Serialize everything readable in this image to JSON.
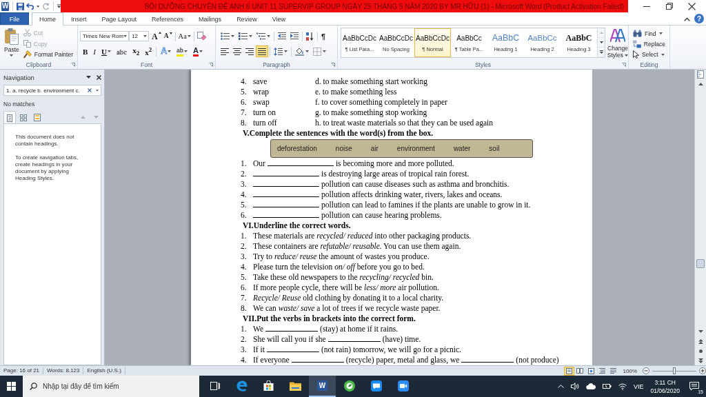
{
  "window": {
    "app_letter": "W",
    "title": "BỒI DƯỠNG CHUYÊN ĐỀ ANH 6 UNIT 11 SUPERVIP GROUP NGÀY 25 THÁNG 5 NĂM 2020 BY MR HỮU (1) - Microsoft Word (Product Activation Failed)"
  },
  "quick_access": [
    {
      "kind": "save",
      "disabled": false
    },
    {
      "kind": "undo",
      "disabled": false
    },
    {
      "kind": "redo",
      "disabled": true
    }
  ],
  "ribbon_tabs": [
    {
      "label": "File",
      "kind": "file",
      "selected": false
    },
    {
      "label": "Home",
      "kind": "tab",
      "selected": true
    },
    {
      "label": "Insert",
      "kind": "tab",
      "selected": false
    },
    {
      "label": "Page Layout",
      "kind": "tab",
      "selected": false
    },
    {
      "label": "References",
      "kind": "tab",
      "selected": false
    },
    {
      "label": "Mailings",
      "kind": "tab",
      "selected": false
    },
    {
      "label": "Review",
      "kind": "tab",
      "selected": false
    },
    {
      "label": "View",
      "kind": "tab",
      "selected": false
    }
  ],
  "help": "?",
  "clipboard": {
    "paste": "Paste",
    "commands": [
      {
        "kind": "cut",
        "label": "Cut",
        "disabled": true
      },
      {
        "kind": "copy",
        "label": "Copy",
        "disabled": true
      },
      {
        "kind": "format_painter",
        "label": "Format Painter",
        "disabled": false
      }
    ],
    "label": "Clipboard"
  },
  "font": {
    "name": "Times New Rom",
    "size": "12",
    "grow": "A",
    "shrink": "A",
    "change_case": "Aa",
    "formats": [
      {
        "kind": "bold",
        "label": "B",
        "menu": false
      },
      {
        "kind": "italic",
        "label": "I",
        "menu": false
      },
      {
        "kind": "underline",
        "label": "U",
        "menu": true
      },
      {
        "kind": "strikethrough",
        "label": "abc",
        "menu": false
      },
      {
        "kind": "subscript",
        "label": "x$_{2}$",
        "menu": false
      },
      {
        "kind": "superscript",
        "label": "x$^{2}$",
        "menu": false
      }
    ],
    "effects": [
      {
        "kind": "text_effects",
        "label": "A"
      },
      {
        "kind": "highlight",
        "label": "ab"
      },
      {
        "kind": "font_color",
        "label": "A"
      }
    ],
    "label": "Font"
  },
  "paragraph": {
    "show_marks": "¶",
    "align": [
      {
        "kind": "left",
        "selected": false
      },
      {
        "kind": "center",
        "selected": false
      },
      {
        "kind": "right",
        "selected": false
      },
      {
        "kind": "justify",
        "selected": true
      }
    ],
    "label": "Paragraph"
  },
  "styles": {
    "gallery": [
      {
        "preview": "AaBbCcDc",
        "name": "¶ List Para...",
        "kind": "body",
        "selected": false
      },
      {
        "preview": "AaBbCcDc",
        "name": "No Spacing",
        "kind": "body",
        "selected": false
      },
      {
        "preview": "AaBbCcDc",
        "name": "¶ Normal",
        "kind": "body",
        "selected": true
      },
      {
        "preview": "AaBbCc",
        "name": "¶ Table Pa...",
        "kind": "body",
        "selected": false
      },
      {
        "preview": "AaBbC",
        "name": "Heading 1",
        "kind": "heading1",
        "selected": false
      },
      {
        "preview": "AaBbCc",
        "name": "Heading 2",
        "kind": "heading2",
        "selected": false
      },
      {
        "preview": "AaBbC",
        "name": "Heading 3",
        "kind": "heading3",
        "selected": false
      }
    ],
    "change_styles": "Change Styles",
    "label": "Styles"
  },
  "editing": {
    "commands": [
      {
        "kind": "find",
        "label": "Find",
        "menu": true
      },
      {
        "kind": "replace",
        "label": "Replace",
        "menu": false
      },
      {
        "kind": "select",
        "label": "Select",
        "menu": true
      }
    ],
    "label": "Editing"
  },
  "navigation": {
    "title": "Navigation",
    "search": {
      "value": "1. a. recycle b. environment c."
    },
    "status": "No matches",
    "view_tabs": [
      {
        "kind": "headings",
        "selected": true
      },
      {
        "kind": "pages",
        "selected": false
      },
      {
        "kind": "results",
        "selected": false
      }
    ],
    "result_arrows": [
      {
        "kind": "previous",
        "disabled": true
      },
      {
        "kind": "next",
        "disabled": true
      }
    ],
    "message": [
      "This document does not contain headings.",
      "To create navigation tabs, create headings in your document by applying Heading Styles."
    ]
  },
  "document": {
    "matching": [
      {
        "number": "4.",
        "word": "save",
        "definition": "d. to make something start working"
      },
      {
        "number": "5.",
        "word": "wrap",
        "definition": "e. to make something less"
      },
      {
        "number": "6.",
        "word": "swap",
        "definition": "f. to cover something completely in paper"
      },
      {
        "number": "7.",
        "word": "turn on",
        "definition": "g. to make something stop working"
      },
      {
        "number": "8.",
        "word": "turn off",
        "definition": "h. to treat waste materials so that they can be used again"
      }
    ],
    "exercise_5": {
      "heading": "V.Complete the sentences with the word(s) from the box.",
      "word_box": [
        "deforestation",
        "noise",
        "air",
        "environment",
        "water",
        "soil"
      ],
      "items": [
        {
          "number": "1.",
          "parts": [
            {
              "kind": "text",
              "text": "Our"
            },
            {
              "kind": "blank"
            },
            {
              "kind": "text",
              "text": "is becoming more and more polluted."
            }
          ]
        },
        {
          "number": "2.",
          "parts": [
            {
              "kind": "blank"
            },
            {
              "kind": "text",
              "text": "is destroying large areas of tropical rain forest."
            }
          ]
        },
        {
          "number": "3.",
          "parts": [
            {
              "kind": "blank"
            },
            {
              "kind": "text",
              "text": "pollution can cause diseases such as asthma and bronchitis."
            }
          ]
        },
        {
          "number": "4.",
          "parts": [
            {
              "kind": "blank"
            },
            {
              "kind": "text",
              "text": "pollution affects drinking water, rivers, lakes and oceans."
            }
          ]
        },
        {
          "number": "5.",
          "parts": [
            {
              "kind": "blank"
            },
            {
              "kind": "text",
              "text": "pollution can lead to famines if the plants are unable to grow in it."
            }
          ]
        },
        {
          "number": "6.",
          "parts": [
            {
              "kind": "blank"
            },
            {
              "kind": "text",
              "text": "pollution can cause hearing problems."
            }
          ]
        }
      ]
    },
    "exercise_6": {
      "heading": "VI.Underline the correct words.",
      "items": [
        {
          "number": "1.",
          "text": "These materials are *recycled/ reduced* into other packaging products."
        },
        {
          "number": "2.",
          "text": "These containers are *refutable/ reusable.* You can use them again."
        },
        {
          "number": "3.",
          "text": "Try to *reduce/ reuse* the amount of wastes you produce."
        },
        {
          "number": "4.",
          "text": "Please turn the television *on/ off* before you go to bed."
        },
        {
          "number": "5.",
          "text": "Take these old newspapers to the *recycling/ recycled* bin."
        },
        {
          "number": "6.",
          "text": "If more people cycle, there will be *less/ more* air pollution."
        },
        {
          "number": "7.",
          "text": "*Recycle/ Reuse* old clothing by donating it to a local charity."
        },
        {
          "number": "8.",
          "text": "We can *waste/ save* a lot of trees if we recycle waste paper."
        }
      ]
    },
    "exercise_7": {
      "heading": "VII.Put the verbs in brackets into the correct form.",
      "items": [
        {
          "number": "1.",
          "parts": [
            {
              "kind": "text",
              "text": "We"
            },
            {
              "kind": "blank"
            },
            {
              "kind": "text",
              "text": "(stay) at home if it rains."
            }
          ]
        },
        {
          "number": "2.",
          "parts": [
            {
              "kind": "text",
              "text": "She will call you if she"
            },
            {
              "kind": "blank"
            },
            {
              "kind": "text",
              "text": "(have) time."
            }
          ]
        },
        {
          "number": "3.",
          "parts": [
            {
              "kind": "text",
              "text": "If it"
            },
            {
              "kind": "blank"
            },
            {
              "kind": "text",
              "text": "(not rain) tomorrow, we will go for a picnic."
            }
          ]
        },
        {
          "number": "4.",
          "parts": [
            {
              "kind": "text",
              "text": "If everyone"
            },
            {
              "kind": "blank"
            },
            {
              "kind": "text",
              "text": "(recycle) paper, metal and glass, we"
            },
            {
              "kind": "blank"
            },
            {
              "kind": "text",
              "text": "(not produce)"
            }
          ]
        }
      ]
    }
  },
  "status_bar": {
    "page": "Page: 16 of 21",
    "words": "Words: 8.123",
    "language": "English (U.S.)",
    "views": [
      {
        "kind": "print",
        "selected": true
      },
      {
        "kind": "reading",
        "selected": false
      },
      {
        "kind": "web",
        "selected": false
      },
      {
        "kind": "outline",
        "selected": false
      },
      {
        "kind": "draft",
        "selected": false
      }
    ],
    "zoom": {
      "label": "100%",
      "level": 0.5
    }
  },
  "taskbar": {
    "search": {
      "placeholder": "Nhập tại đây để tìm kiếm"
    },
    "apps": [
      {
        "kind": "taskview",
        "selected": false
      },
      {
        "kind": "edge",
        "selected": false
      },
      {
        "kind": "store",
        "selected": false
      },
      {
        "kind": "explorer",
        "selected": false
      },
      {
        "kind": "word",
        "label": "W",
        "selected": true
      },
      {
        "kind": "coccoc",
        "selected": false
      },
      {
        "kind": "zalo",
        "selected": false
      },
      {
        "kind": "zoom",
        "selected": false
      }
    ],
    "language": "VIE",
    "time": "3:11 CH",
    "date": "01/06/2020",
    "notifications": "15"
  }
}
